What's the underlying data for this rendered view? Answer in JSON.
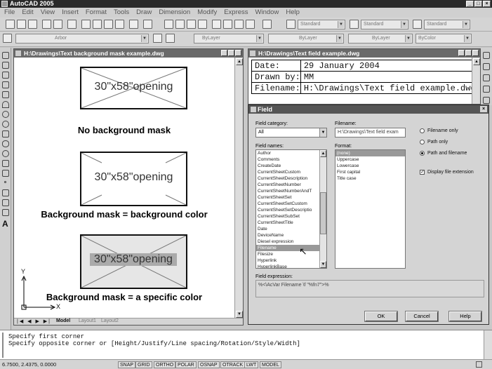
{
  "app": {
    "title": "AutoCAD 2005"
  },
  "menu": [
    "File",
    "Edit",
    "View",
    "Insert",
    "Format",
    "Tools",
    "Draw",
    "Dimension",
    "Modify",
    "Express",
    "Window",
    "Help"
  ],
  "toolbar": {
    "textstyle": "Standard",
    "dimstyle": "Standard",
    "tablestyle": "Standard",
    "layer": "Arbor",
    "color": "ByLayer",
    "linetype": "ByLayer",
    "lineweight": "ByLayer",
    "plotstyle": "ByColor"
  },
  "doc1": {
    "title": "H:\\Drawings\\Text background mask example.dwg",
    "opening_text": "30\"x58\"opening",
    "captions": [
      "No background mask",
      "Background mask = background color",
      "Background mask = a specific color"
    ],
    "tabs": [
      "Model",
      "Layout1",
      "Layout2"
    ],
    "ucs_y": "Y",
    "ucs_x": "X"
  },
  "doc2": {
    "title": "H:\\Drawings\\Text field example.dwg",
    "rows": [
      {
        "label": "Date:",
        "value": "29 January 2004"
      },
      {
        "label": "Drawn by:",
        "value": "MM"
      },
      {
        "label": "Filename:",
        "value": "H:\\Drawings\\Text field example.dwg"
      }
    ]
  },
  "dialog": {
    "title": "Field",
    "category_label": "Field category:",
    "category_value": "All",
    "names_label": "Field names:",
    "field_names": [
      "Author",
      "Comments",
      "CreateDate",
      "CurrentSheetCustom",
      "CurrentSheetDescription",
      "CurrentSheetNumber",
      "CurrentSheetNumberAndT",
      "CurrentSheetSet",
      "CurrentSheetSetCustom",
      "CurrentSheetSetDescriptio",
      "CurrentSheetSubSet",
      "CurrentSheetTitle",
      "Date",
      "DeviceName",
      "Diesel expression",
      "Filename",
      "Filesize",
      "Hyperlink",
      "HyperlinkBase"
    ],
    "selected_name": "Filename",
    "filename_label": "Filename:",
    "filename_value": "H:\\Drawings\\Text field exam",
    "format_label": "Format:",
    "formats": [
      "(none)",
      "Uppercase",
      "Lowercase",
      "First capital",
      "Title case"
    ],
    "selected_format": "(none)",
    "radio_options": [
      "Filename only",
      "Path only",
      "Path and filename"
    ],
    "radio_selected": "Path and filename",
    "checkbox_label": "Display file extension",
    "checkbox_checked": true,
    "expression_label": "Field expression:",
    "expression_value": "%<\\AcVar Filename \\f \"%fn7\">%",
    "buttons": {
      "ok": "OK",
      "cancel": "Cancel",
      "help": "Help"
    }
  },
  "command": {
    "line1": "Specify first corner",
    "line2": "Specify opposite corner or [Height/Justify/Line spacing/Rotation/Style/Width]"
  },
  "status": {
    "coords": "6.7500, 2.4375, 0.0000",
    "toggles": [
      "SNAP",
      "GRID",
      "ORTHO",
      "POLAR",
      "OSNAP",
      "OTRACK",
      "LWT",
      "MODEL"
    ]
  }
}
